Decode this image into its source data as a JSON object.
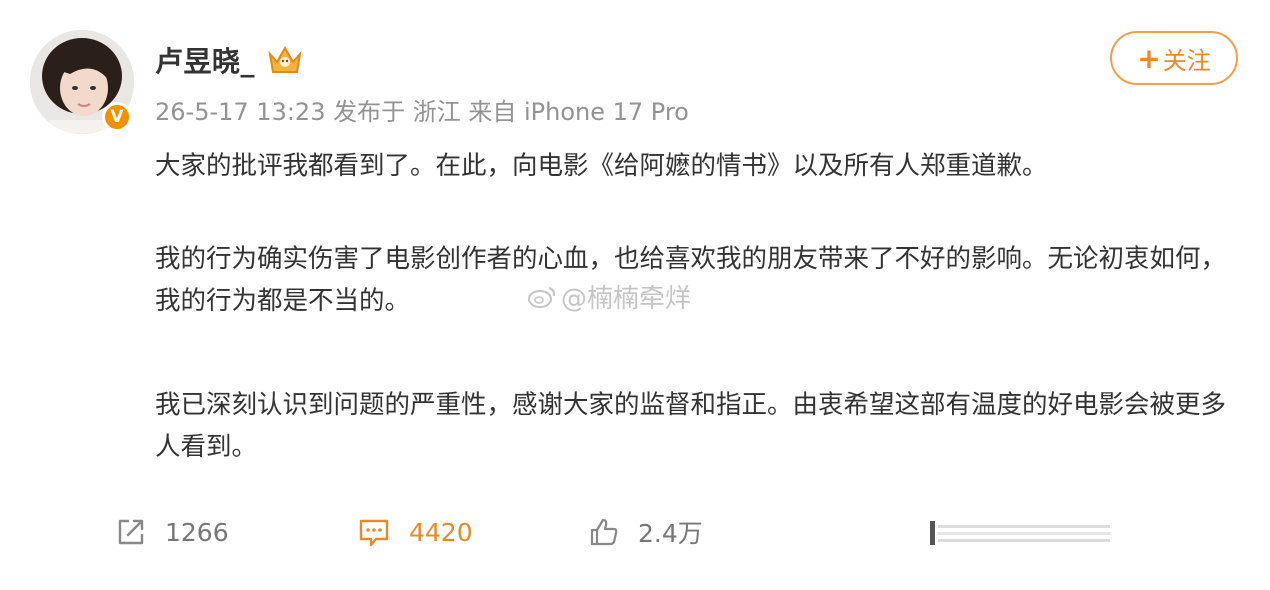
{
  "user": {
    "name": "卢昱晓_",
    "meta": "26-5-17 13:23 发布于 浙江 来自 iPhone 17 Pro"
  },
  "follow_button": {
    "plus": "+",
    "label": "关注"
  },
  "post": {
    "paragraphs": [
      "大家的批评我都看到了。在此，向电影《给阿嬷的情书》以及所有人郑重道歉。",
      "我的行为确实伤害了电影创作者的心血，也给喜欢我的朋友带来了不好的影响。无论初衷如何，我的行为都是不当的。",
      "我已深刻认识到问题的严重性，感谢大家的监督和指正。由衷希望这部有温度的好电影会被更多人看到。"
    ]
  },
  "watermark": "@楠楠牵烊",
  "actions": {
    "repost_count": "1266",
    "comment_count": "4420",
    "like_count": "2.4万"
  },
  "colors": {
    "accent": "#e88a2a",
    "text": "#333333",
    "meta": "#939393"
  }
}
